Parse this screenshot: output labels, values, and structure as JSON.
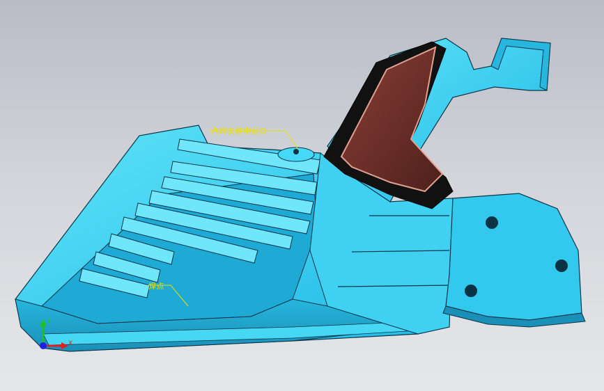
{
  "annotations": {
    "top_note": "点焊安装中丝口",
    "bottom_note": "焊点"
  },
  "triad": {
    "x_label": "X",
    "y_label": "Y"
  },
  "colors": {
    "background_top": "#b9bcc6",
    "background_bottom": "#e6e7ea",
    "part_cyan": "#2fd1f2",
    "part_shadow": "#1a8fb8",
    "edge": "#0b3346",
    "grip_brown": "#6b2f2a",
    "grip_rim": "#e2a190",
    "annotation_yellow": "#e8e000",
    "axis_x": "#e02020",
    "axis_y": "#20c020",
    "axis_z": "#2020e0"
  },
  "icons": [
    "coordinate-triad-icon",
    "annotation-leader-icon"
  ]
}
